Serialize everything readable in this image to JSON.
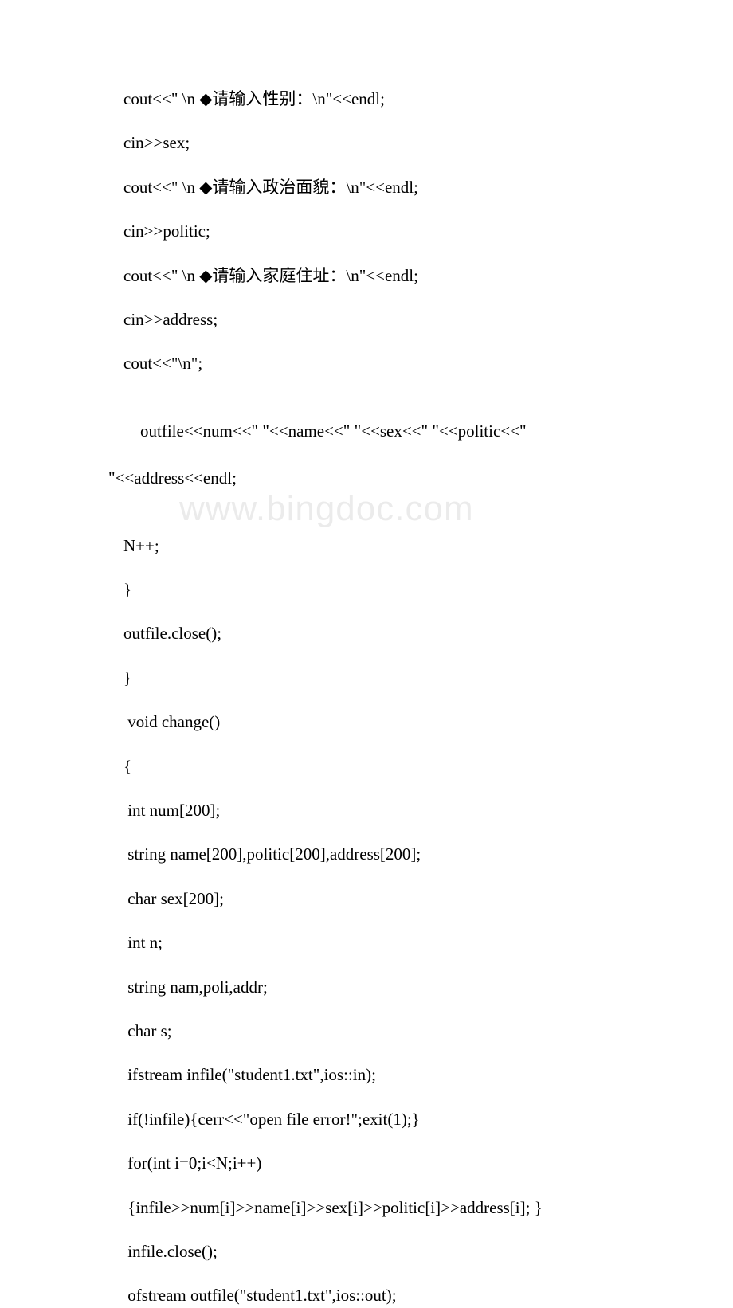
{
  "watermark": "www.bingdoc.com",
  "lines": [
    "cout<<\" \\n ◆请输入性别：\\n\"<<endl;",
    "cin>>sex;",
    "cout<<\" \\n ◆请输入政治面貌：\\n\"<<endl;",
    "cin>>politic;",
    "cout<<\" \\n ◆请输入家庭住址：\\n\"<<endl;",
    "cin>>address;",
    "cout<<\"\\n\";",
    "outfile<<num<<\" \"<<name<<\" \"<<sex<<\" \"<<politic<<\" \"<<address<<endl;",
    "N++;",
    "}",
    "outfile.close();",
    "}",
    " void change()",
    "{",
    " int num[200];",
    " string name[200],politic[200],address[200];",
    " char sex[200];",
    " int n;",
    " string nam,poli,addr;",
    " char s;",
    " ifstream infile(\"student1.txt\",ios::in);",
    " if(!infile){cerr<<\"open file error!\";exit(1);}",
    " for(int i=0;i<N;i++)",
    " {infile>>num[i]>>name[i]>>sex[i]>>politic[i]>>address[i]; }",
    " infile.close();",
    " ofstream outfile(\"student1.txt\",ios::out);"
  ],
  "special_line": {
    "index": 7,
    "part1": "outfile<<num<<\" \"<<name<<\" \"<<sex<<\" \"<<politic<<\"",
    "part2": "\"<<address<<endl;"
  }
}
